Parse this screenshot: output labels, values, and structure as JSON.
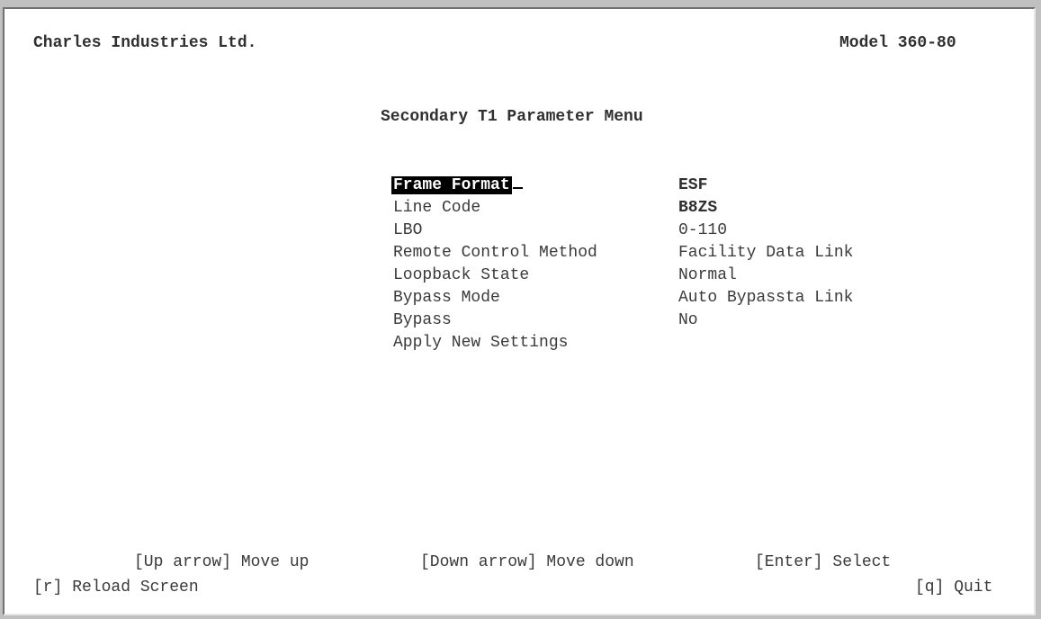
{
  "header": {
    "company": "Charles Industries Ltd.",
    "model": "Model 360-80"
  },
  "menu": {
    "title": "Secondary T1 Parameter Menu",
    "items": [
      {
        "label": "Frame Format",
        "value": "ESF",
        "selected": true
      },
      {
        "label": "Line Code",
        "value": "B8ZS"
      },
      {
        "label": "LBO",
        "value": "0-110"
      },
      {
        "label": "Remote Control Method",
        "value": "Facility Data Link"
      },
      {
        "label": "Loopback State",
        "value": "Normal"
      },
      {
        "label": "Bypass Mode",
        "value": "Auto Bypassta Link"
      },
      {
        "label": "Bypass",
        "value": "No"
      },
      {
        "label": "Apply New Settings",
        "value": ""
      }
    ]
  },
  "footer": {
    "up_hint": "[Up arrow] Move up",
    "down_hint": "[Down arrow] Move down",
    "enter_hint": "[Enter] Select",
    "reload_hint": "[r] Reload Screen",
    "quit_hint": "[q] Quit"
  },
  "colors": {
    "background": "#ffffff",
    "text": "#3a3a3a",
    "highlight": "#000000"
  }
}
